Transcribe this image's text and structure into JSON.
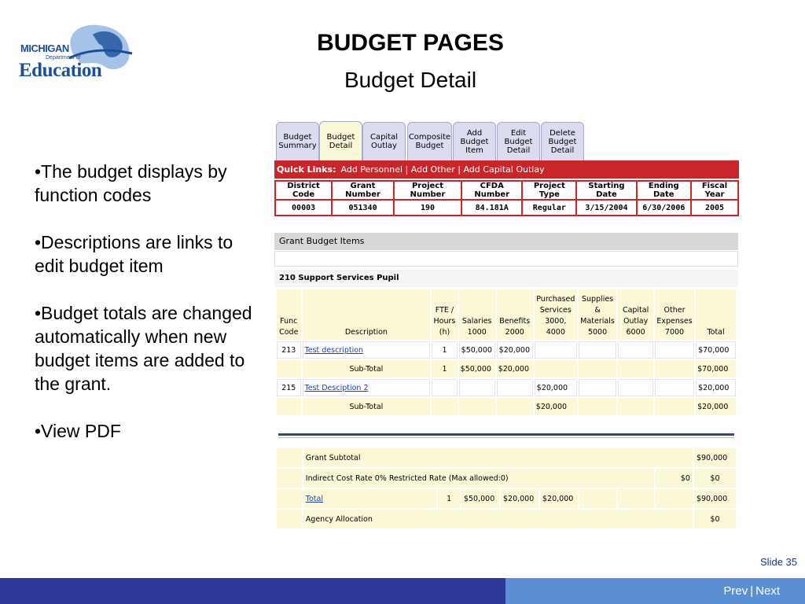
{
  "logo": {
    "state": "MICHIGAN",
    "dept": "Department of",
    "name": "Education"
  },
  "title": "BUDGET PAGES",
  "subtitle": "Budget Detail",
  "bullets": [
    "•The budget displays by  function codes",
    "•Descriptions are links to edit budget item",
    "•Budget totals are changed automatically when new budget items are added to the grant.",
    "•View PDF"
  ],
  "tabs": [
    {
      "label": "Budget Summary"
    },
    {
      "label": "Budget Detail"
    },
    {
      "label": "Capital Outlay"
    },
    {
      "label": "Composite Budget"
    },
    {
      "label": "Add Budget Item"
    },
    {
      "label": "Edit Budget Detail"
    },
    {
      "label": "Delete Budget Detail"
    }
  ],
  "quick_links": {
    "label": "Quick Links:",
    "links": "Add Personnel | Add Other | Add Capital Outlay"
  },
  "info_headers": [
    "District Code",
    "Grant Number",
    "Project Number",
    "CFDA Number",
    "Project Type",
    "Starting Date",
    "Ending Date",
    "Fiscal Year"
  ],
  "info_values": [
    "00003",
    "051340",
    "190",
    "84.181A",
    "Regular",
    "3/15/2004",
    "6/30/2006",
    "2005"
  ],
  "grant": {
    "heading": "Grant Budget Items",
    "section": "210 Support Services Pupil"
  },
  "col_headers": [
    "Func Code",
    "Description",
    "FTE / Hours (h)",
    "Salaries 1000",
    "Benefits 2000",
    "Purchased Services 3000, 4000",
    "Supplies & Materials 5000",
    "Capital Outlay 6000",
    "Other Expenses 7000",
    "Total"
  ],
  "rows": [
    {
      "code": "213",
      "desc": "Test description",
      "fte": "1",
      "sal": "$50,000",
      "ben": "$20,000",
      "pur": "",
      "sup": "",
      "cap": "",
      "oth": "",
      "tot": "$70,000"
    },
    {
      "code": "",
      "desc": "Sub-Total",
      "fte": "1",
      "sal": "$50,000",
      "ben": "$20,000",
      "pur": "",
      "sup": "",
      "cap": "",
      "oth": "",
      "tot": "$70,000"
    },
    {
      "code": "215",
      "desc": "Test Desciption 2",
      "fte": "",
      "sal": "",
      "ben": "",
      "pur": "$20,000",
      "sup": "",
      "cap": "",
      "oth": "",
      "tot": "$20,000"
    },
    {
      "code": "",
      "desc": "Sub-Total",
      "fte": "",
      "sal": "",
      "ben": "",
      "pur": "$20,000",
      "sup": "",
      "cap": "",
      "oth": "",
      "tot": "$20,000"
    }
  ],
  "totals": {
    "grant_subtotal_label": "Grant Subtotal",
    "grant_subtotal": "$90,000",
    "indirect_label": "Indirect Cost Rate 0% Restricted Rate (Max allowed:0)",
    "indirect_other": "$0",
    "indirect_total": "$0",
    "total_label": "Total",
    "total_fte": "1",
    "total_sal": "$50,000",
    "total_ben": "$20,000",
    "total_pur": "$20,000",
    "total": "$90,000",
    "agency_label": "Agency Allocation",
    "agency_total": "$0"
  },
  "slide_number": "Slide 35",
  "nav": {
    "prev": "Prev",
    "sep": "|",
    "next": "Next"
  },
  "colors": {
    "accent_red": "#c9262c",
    "footer_dark": "#2e3a98",
    "footer_light": "#5b8fd4",
    "highlight": "#fbf8d8"
  }
}
